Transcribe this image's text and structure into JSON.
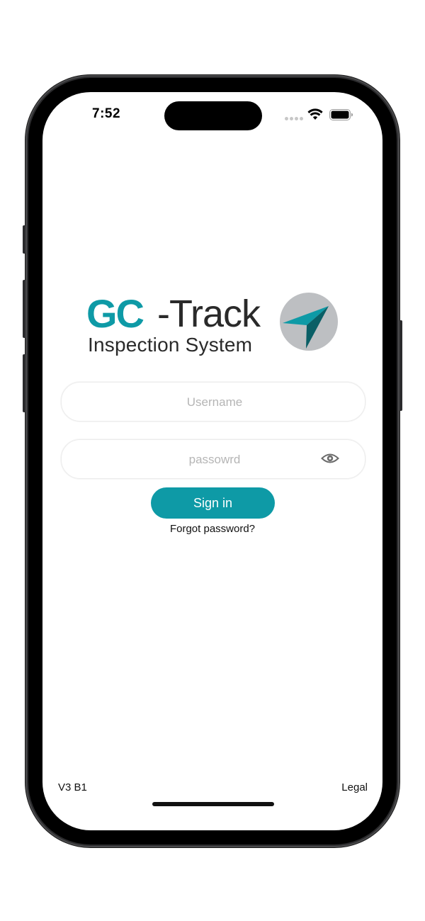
{
  "status_bar": {
    "time": "7:52",
    "icons": [
      "cellular-signal-icon",
      "wifi-icon",
      "battery-icon"
    ]
  },
  "logo": {
    "brand_prefix": "GC",
    "brand_suffix": "-Track",
    "subtitle": "Inspection System",
    "emblem": "navigation-arrow-icon"
  },
  "form": {
    "username_placeholder": "Username",
    "password_placeholder": "passowrd",
    "password_toggle_icon": "eye-icon",
    "signin_label": "Sign in",
    "forgot_label": "Forgot password?"
  },
  "footer": {
    "version": "V3 B1",
    "legal_label": "Legal"
  },
  "colors": {
    "accent": "#0e9aa6",
    "text_dark": "#2a2a2a",
    "emblem_circle": "#bdbfc2",
    "emblem_arrow_dark": "#0a5f66"
  }
}
